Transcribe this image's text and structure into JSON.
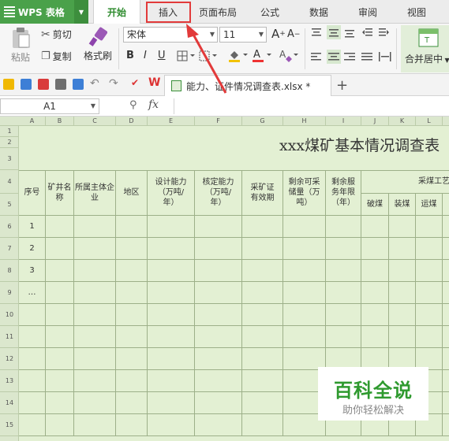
{
  "app": {
    "logo_text": "WPS 表格"
  },
  "tabs": [
    "开始",
    "插入",
    "页面布局",
    "公式",
    "数据",
    "审阅",
    "视图"
  ],
  "ribbon": {
    "paste": "粘贴",
    "cut": "剪切",
    "copy": "复制",
    "format_painter": "格式刷",
    "font_name": "宋体",
    "font_size": "11",
    "bold": "B",
    "italic": "I",
    "underline": "U",
    "merge_center": "合并居中"
  },
  "document": {
    "tab_title": "能力、证件情况调查表.xlsx *",
    "add_tab": "+"
  },
  "formula_bar": {
    "name_box": "A1",
    "fx": "fx"
  },
  "sheet": {
    "columns": [
      "A",
      "B",
      "C",
      "D",
      "E",
      "F",
      "G",
      "H",
      "I",
      "J",
      "K",
      "L"
    ],
    "rows": [
      "1",
      "2",
      "3",
      "4",
      "5",
      "6",
      "7",
      "8",
      "9",
      "10",
      "11",
      "12",
      "13",
      "14",
      "15"
    ],
    "title": "xxx煤矿基本情况调查表",
    "headers": {
      "seq": "序号",
      "mine_name": "矿井名称",
      "owner": "所属主体企业",
      "region": "地区",
      "design_capacity": "设计能力（万吨/年）",
      "verified_capacity": "核定能力（万吨/年）",
      "license_validity": "采矿证有效期",
      "remaining_reserve": "剩余可采储量（万吨）",
      "remaining_years": "剩余服务年限（年）",
      "mining_process": "采煤工艺",
      "blasting": "破煤",
      "loading": "装煤",
      "transport": "运煤"
    },
    "seq_values": [
      "1",
      "2",
      "3",
      "…"
    ]
  },
  "watermark": {
    "title": "百科全说",
    "subtitle": "助你轻松解决"
  }
}
